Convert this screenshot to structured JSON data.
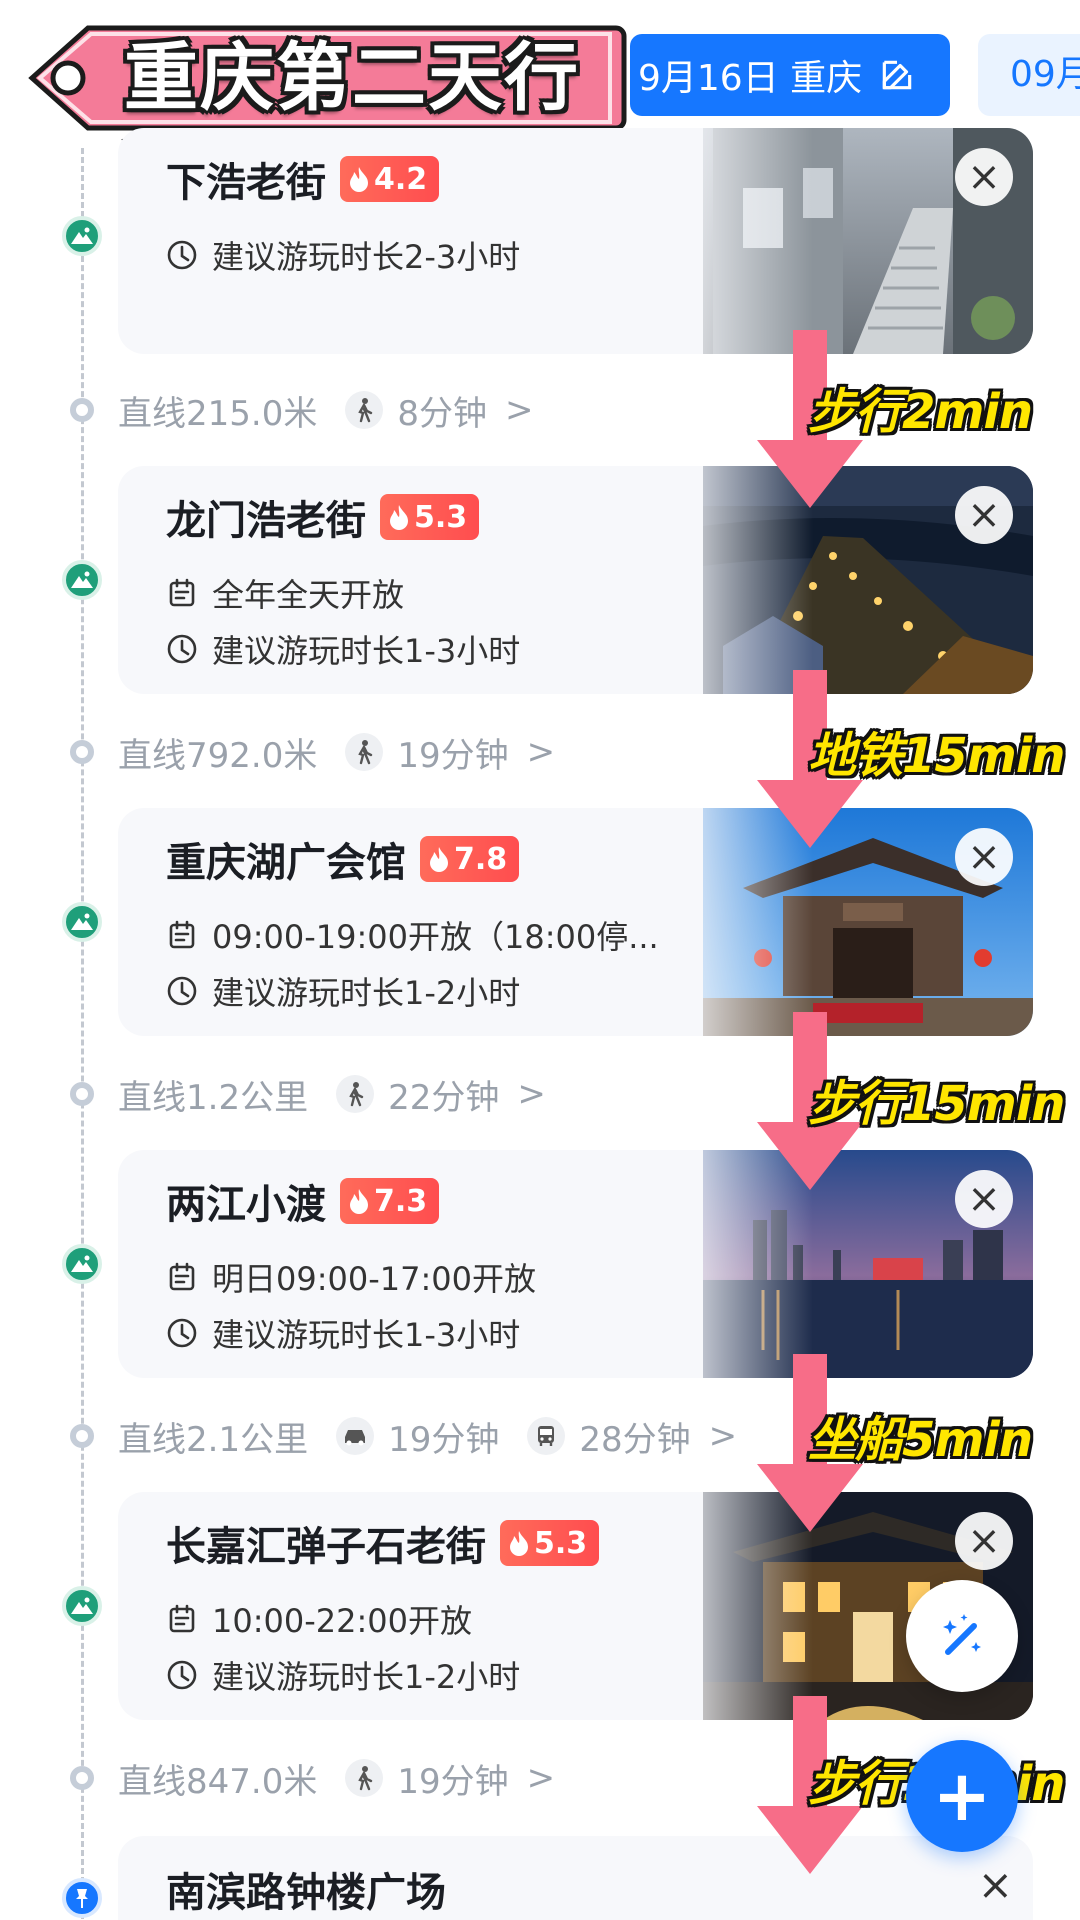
{
  "header": {
    "title": "重庆第二天行程",
    "date_label": "9月16日 重庆",
    "next_date_label": "09月"
  },
  "spots": [
    {
      "name": "下浩老街",
      "heat": "4.2",
      "lines": [
        {
          "icon": "clock-icon",
          "text": "建议游玩时长2-3小时"
        }
      ],
      "photo": "old-street-stairs"
    },
    {
      "name": "龙门浩老街",
      "heat": "5.3",
      "lines": [
        {
          "icon": "calendar-icon",
          "text": "全年全天开放"
        },
        {
          "icon": "clock-icon",
          "text": "建议游玩时长1-3小时"
        }
      ],
      "photo": "night-riverside-street"
    },
    {
      "name": "重庆湖广会馆",
      "heat": "7.8",
      "lines": [
        {
          "icon": "calendar-icon",
          "text": "09:00-19:00开放（18:00停..."
        },
        {
          "icon": "clock-icon",
          "text": "建议游玩时长1-2小时"
        }
      ],
      "photo": "guild-hall-gate"
    },
    {
      "name": "两江小渡",
      "heat": "7.3",
      "lines": [
        {
          "icon": "calendar-icon",
          "text": "明日09:00-17:00开放"
        },
        {
          "icon": "clock-icon",
          "text": "建议游玩时长1-3小时"
        }
      ],
      "photo": "night-skyline-river"
    },
    {
      "name": "长嘉汇弹子石老街",
      "heat": "5.3",
      "lines": [
        {
          "icon": "calendar-icon",
          "text": "10:00-22:00开放"
        },
        {
          "icon": "clock-icon",
          "text": "建议游玩时长1-2小时"
        }
      ],
      "photo": "lit-old-building"
    }
  ],
  "legs": [
    {
      "distance": "直线215.0米",
      "modes": [
        {
          "icon": "walk-icon",
          "time": "8分钟"
        }
      ]
    },
    {
      "distance": "直线792.0米",
      "modes": [
        {
          "icon": "walk-icon",
          "time": "19分钟"
        }
      ]
    },
    {
      "distance": "直线1.2公里",
      "modes": [
        {
          "icon": "walk-icon",
          "time": "22分钟"
        }
      ]
    },
    {
      "distance": "直线2.1公里",
      "modes": [
        {
          "icon": "car-icon",
          "time": "19分钟"
        },
        {
          "icon": "bus-icon",
          "time": "28分钟"
        }
      ]
    },
    {
      "distance": "直线847.0米",
      "modes": [
        {
          "icon": "walk-icon",
          "time": "19分钟"
        }
      ]
    }
  ],
  "overlay_labels": [
    "步行2min",
    "地铁15min",
    "步行15min",
    "坐船5min",
    "步行10min"
  ],
  "last_spot": {
    "name": "南滨路钟楼广场"
  },
  "colors": {
    "accent": "#1677ff",
    "spot_dot": "#1f9f7a",
    "heat_badge": "#ff4d4f",
    "arrow_pink": "#f76d88",
    "overlay_text": "#ffe600"
  }
}
